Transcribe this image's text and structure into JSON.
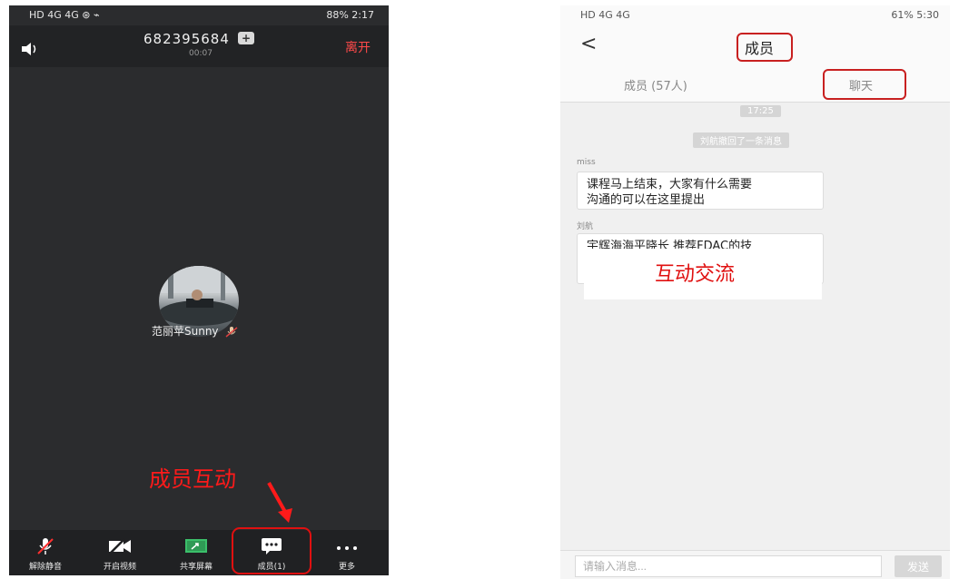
{
  "left": {
    "status_left": "HD 4G 4G ⊛ ⌁",
    "status_right": "88% 2:17",
    "meeting_id": "682395684",
    "timer": "00:07",
    "leave_label": "离开",
    "username": "范丽苹Sunny",
    "annotation": "成员互动",
    "toolbar": [
      {
        "label": "解除静音"
      },
      {
        "label": "开启视频"
      },
      {
        "label": "共享屏幕"
      },
      {
        "label": "成员(1)"
      },
      {
        "label": "更多"
      }
    ],
    "colors": {
      "accent_red": "#ff1a1a",
      "background": "#2b2c2e"
    }
  },
  "right": {
    "status_left": "HD 4G 4G",
    "status_right": "61% 5:30",
    "title": "成员",
    "tab_members": "成员 (57人)",
    "tab_chat": "聊天",
    "time_pill": "17:25",
    "recall_notice": "刘航撤回了一条消息",
    "messages": [
      {
        "sender": "miss",
        "text_line1": "课程马上结束，大家有什么需要",
        "text_line2": "沟通的可以在这里提出"
      },
      {
        "sender": "刘航",
        "text_line1": "宇辉海海平晓长 推荐FDAC的技"
      }
    ],
    "overlay_annotation": "互动交流",
    "input_placeholder": "请输入消息...",
    "send_label": "发送"
  }
}
